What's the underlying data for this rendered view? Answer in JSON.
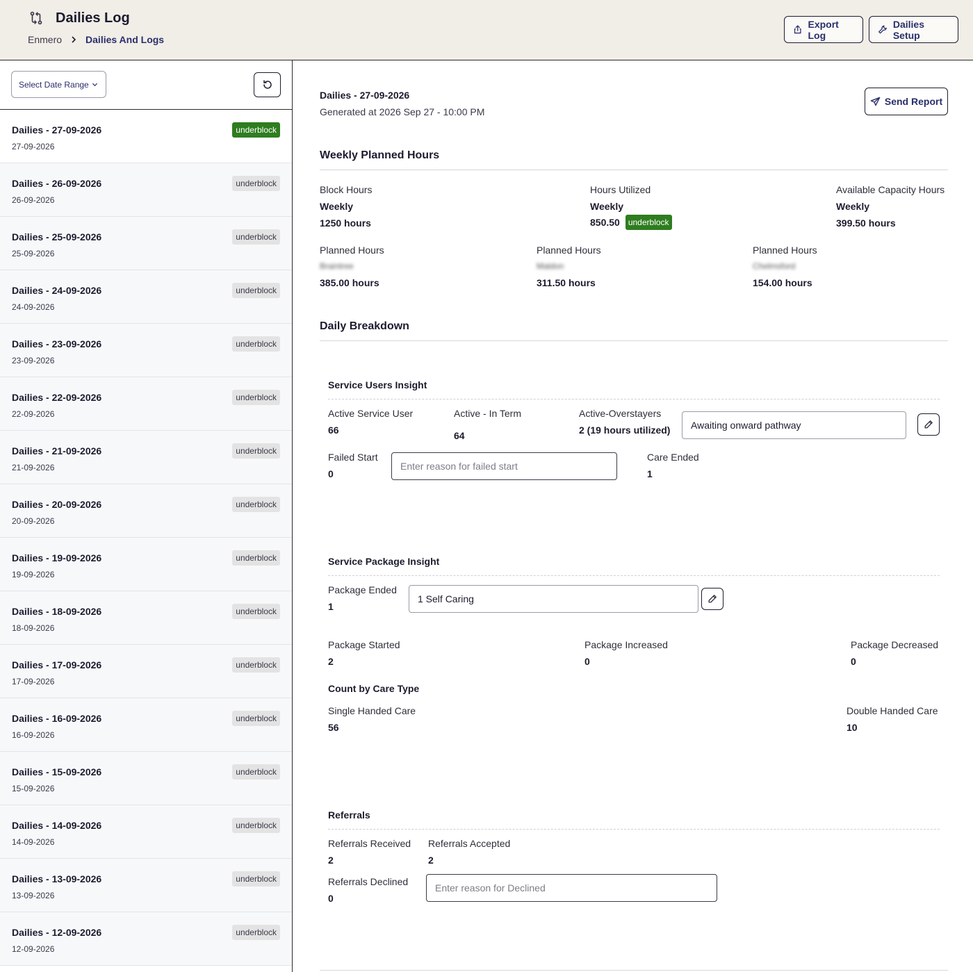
{
  "header": {
    "title": "Dailies Log",
    "breadcrumb": {
      "root": "Enmero",
      "current": "Dailies And Logs"
    },
    "export_label": "Export Log",
    "setup_label": "Dailies Setup"
  },
  "sidebar": {
    "date_range_label": "Select Date Range",
    "items": [
      {
        "title": "Dailies - 27-09-2026",
        "date": "27-09-2026",
        "badge": "underblock",
        "active": true
      },
      {
        "title": "Dailies - 26-09-2026",
        "date": "26-09-2026",
        "badge": "underblock"
      },
      {
        "title": "Dailies - 25-09-2026",
        "date": "25-09-2026",
        "badge": "underblock"
      },
      {
        "title": "Dailies - 24-09-2026",
        "date": "24-09-2026",
        "badge": "underblock"
      },
      {
        "title": "Dailies - 23-09-2026",
        "date": "23-09-2026",
        "badge": "underblock"
      },
      {
        "title": "Dailies - 22-09-2026",
        "date": "22-09-2026",
        "badge": "underblock"
      },
      {
        "title": "Dailies - 21-09-2026",
        "date": "21-09-2026",
        "badge": "underblock"
      },
      {
        "title": "Dailies - 20-09-2026",
        "date": "20-09-2026",
        "badge": "underblock"
      },
      {
        "title": "Dailies - 19-09-2026",
        "date": "19-09-2026",
        "badge": "underblock"
      },
      {
        "title": "Dailies - 18-09-2026",
        "date": "18-09-2026",
        "badge": "underblock"
      },
      {
        "title": "Dailies - 17-09-2026",
        "date": "17-09-2026",
        "badge": "underblock"
      },
      {
        "title": "Dailies - 16-09-2026",
        "date": "16-09-2026",
        "badge": "underblock"
      },
      {
        "title": "Dailies - 15-09-2026",
        "date": "15-09-2026",
        "badge": "underblock"
      },
      {
        "title": "Dailies - 14-09-2026",
        "date": "14-09-2026",
        "badge": "underblock"
      },
      {
        "title": "Dailies - 13-09-2026",
        "date": "13-09-2026",
        "badge": "underblock"
      },
      {
        "title": "Dailies - 12-09-2026",
        "date": "12-09-2026",
        "badge": "underblock"
      }
    ]
  },
  "detail": {
    "title": "Dailies - 27-09-2026",
    "generated": "Generated at 2026 Sep 27 - 10:00 PM",
    "send_label": "Send Report",
    "weekly": {
      "heading": "Weekly Planned Hours",
      "block": {
        "label": "Block Hours",
        "period": "Weekly",
        "value": "1250 hours"
      },
      "utilized": {
        "label": "Hours Utilized",
        "period": "Weekly",
        "value": "850.50",
        "badge": "underblock"
      },
      "available": {
        "label": "Available Capacity Hours",
        "period": "Weekly",
        "value": "399.50 hours"
      },
      "planned": [
        {
          "label": "Planned Hours",
          "location": "Braintree",
          "value": "385.00 hours"
        },
        {
          "label": "Planned Hours",
          "location": "Maldon",
          "value": "311.50 hours"
        },
        {
          "label": "Planned Hours",
          "location": "Chelmsford",
          "value": "154.00 hours"
        }
      ]
    },
    "daily_heading": "Daily Breakdown",
    "service_users": {
      "heading": "Service Users Insight",
      "active_user": {
        "label": "Active Service User",
        "value": "66"
      },
      "active_term": {
        "label": "Active - In Term",
        "value": "64"
      },
      "overstayers": {
        "label": "Active-Overstayers",
        "value": "2 (19 hours utilized)"
      },
      "overstayers_input": "Awaiting onward pathway",
      "failed_start": {
        "label": "Failed Start",
        "value": "0",
        "placeholder": "Enter reason for failed start"
      },
      "care_ended": {
        "label": "Care Ended",
        "value": "1"
      }
    },
    "service_package": {
      "heading": "Service Package Insight",
      "ended": {
        "label": "Package Ended",
        "value": "1",
        "input": "1 Self Caring"
      },
      "started": {
        "label": "Package Started",
        "value": "2"
      },
      "increased": {
        "label": "Package Increased",
        "value": "0"
      },
      "decreased": {
        "label": "Package Decreased",
        "value": "0"
      },
      "care_type_heading": "Count by Care Type",
      "single": {
        "label": "Single Handed Care",
        "value": "56"
      },
      "double": {
        "label": "Double Handed Care",
        "value": "10"
      }
    },
    "referrals": {
      "heading": "Referrals",
      "received": {
        "label": "Referrals Received",
        "value": "2"
      },
      "accepted": {
        "label": "Referrals Accepted",
        "value": "2"
      },
      "declined": {
        "label": "Referrals Declined",
        "value": "0",
        "placeholder": "Enter reason for Declined"
      }
    }
  },
  "colors": {
    "accent": "#2a2f6b",
    "badge_active": "#2e7d1f",
    "header_bg": "#f1ede7"
  }
}
